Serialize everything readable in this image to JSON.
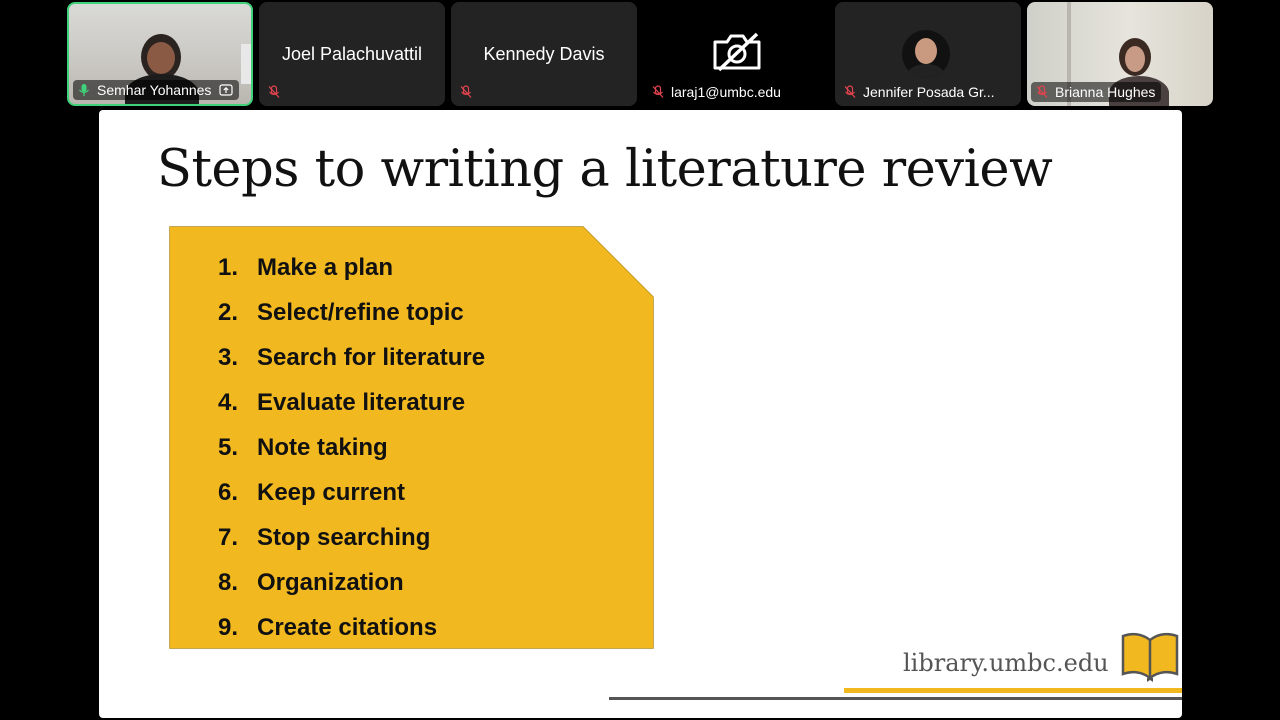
{
  "participants": [
    {
      "name": "Semhar Yohannes",
      "mic": "on",
      "active": true,
      "video": true,
      "badge": "share-screen-icon"
    },
    {
      "name": "Joel Palachuvattil",
      "mic": "muted",
      "video": false
    },
    {
      "name": "Kennedy Davis",
      "mic": "muted",
      "video": false
    },
    {
      "name": "laraj1@umbc.edu",
      "mic": "muted",
      "video": false,
      "camera": "off"
    },
    {
      "name": "Jennifer Posada Gr...",
      "mic": "muted",
      "video": false,
      "avatar": true
    },
    {
      "name": "Brianna Hughes",
      "mic": "muted",
      "video": true
    }
  ],
  "slide": {
    "title": "Steps to writing a literature review",
    "steps": [
      {
        "num": "1.",
        "text": "Make a plan"
      },
      {
        "num": "2.",
        "text": "Select/refine topic"
      },
      {
        "num": "3.",
        "text": "Search for literature"
      },
      {
        "num": "4.",
        "text": "Evaluate literature"
      },
      {
        "num": "5.",
        "text": "Note taking"
      },
      {
        "num": "6.",
        "text": "Keep current"
      },
      {
        "num": "7.",
        "text": "Stop searching"
      },
      {
        "num": "8.",
        "text": "Organization"
      },
      {
        "num": "9.",
        "text": "Create citations"
      }
    ],
    "footer_url": "library.umbc.edu"
  },
  "colors": {
    "panel": "#f2b81f",
    "active_border": "#3fd27a",
    "muted": "#e0444e"
  }
}
